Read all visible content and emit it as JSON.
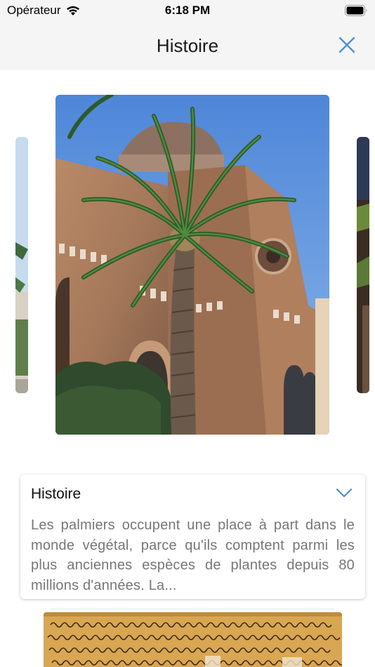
{
  "status_bar": {
    "carrier": "Opérateur",
    "time": "6:18 PM"
  },
  "nav": {
    "title": "Histoire"
  },
  "section": {
    "title": "Histoire",
    "text": "Les palmiers occupent une place à part dans le monde végétal, parce qu'ils comptent parmi les plus anciennes espèces de plantes depuis 80 millions d'années. La..."
  },
  "colors": {
    "accent": "#4a90d9",
    "nav_background": "#f5f5f5",
    "body_text": "#767676"
  },
  "icons": {
    "wifi": "wifi-icon",
    "battery": "battery-icon",
    "close": "close-icon",
    "chevron": "chevron-down-icon"
  }
}
